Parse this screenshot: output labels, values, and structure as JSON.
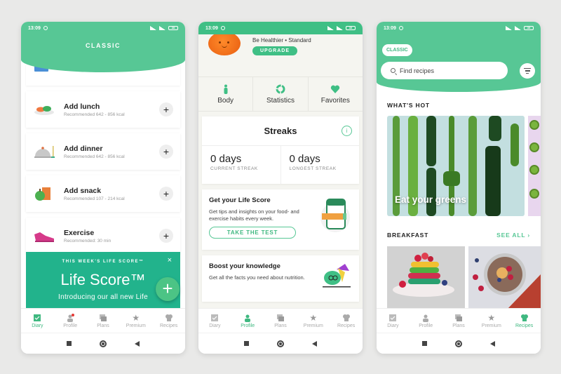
{
  "status_bar": {
    "time": "13:09",
    "battery": "39"
  },
  "bottom_nav": [
    {
      "label": "Diary",
      "icon": "diary-icon"
    },
    {
      "label": "Profile",
      "icon": "profile-icon"
    },
    {
      "label": "Plans",
      "icon": "plans-icon"
    },
    {
      "label": "Premium",
      "icon": "star-icon"
    },
    {
      "label": "Recipes",
      "icon": "chef-hat-icon"
    }
  ],
  "diary_screen": {
    "header_title": "CLASSIC",
    "active_tab": "Diary",
    "meals": [
      {
        "title": "Add lunch",
        "subtitle": "Recommended 642 - 856 kcal",
        "icon": "salad-icon"
      },
      {
        "title": "Add dinner",
        "subtitle": "Recommended 642 - 856 kcal",
        "icon": "cloche-icon"
      },
      {
        "title": "Add snack",
        "subtitle": "Recommended 107 - 214 kcal",
        "icon": "apple-juice-icon"
      },
      {
        "title": "Exercise",
        "subtitle": "Recommended: 30 min",
        "icon": "sneaker-icon"
      }
    ],
    "add_symbol": "+",
    "life_score_banner": {
      "eyebrow": "THIS WEEK'S LIFE SCORE™",
      "title": "Life Score™",
      "body": "Introducing our all new Life",
      "close": "×"
    },
    "fab_symbol": "+"
  },
  "profile_screen": {
    "active_tab": "Profile",
    "plan_text": "Be Healthier • Standard",
    "upgrade_label": "UPGRADE",
    "tiles": [
      {
        "label": "Body",
        "icon": "body-icon"
      },
      {
        "label": "Statistics",
        "icon": "statistics-icon"
      },
      {
        "label": "Favorites",
        "icon": "heart-icon"
      }
    ],
    "streaks": {
      "title": "Streaks",
      "info": "i",
      "current_value": "0 days",
      "current_label": "CURRENT STREAK",
      "longest_value": "0 days",
      "longest_label": "LONGEST STREAK"
    },
    "life_score_card": {
      "title": "Get your Life Score",
      "body": "Get tips and insights on your food- and exercise habits every week.",
      "button": "TAKE THE TEST"
    },
    "knowledge_card": {
      "title": "Boost your knowledge",
      "body": "Get all the facts you need about nutrition."
    }
  },
  "recipes_screen": {
    "active_tab": "Recipes",
    "classic_pill": "CLASSIC",
    "search_placeholder": "Find recipes",
    "whats_hot_title": "WHAT'S HOT",
    "hot_card_label": "Eat your greens",
    "breakfast_title": "BREAKFAST",
    "see_all": "SEE ALL ›"
  },
  "colors": {
    "brand_green": "#57c795",
    "teal_banner": "#22b38c",
    "active_nav": "#3fb880"
  }
}
